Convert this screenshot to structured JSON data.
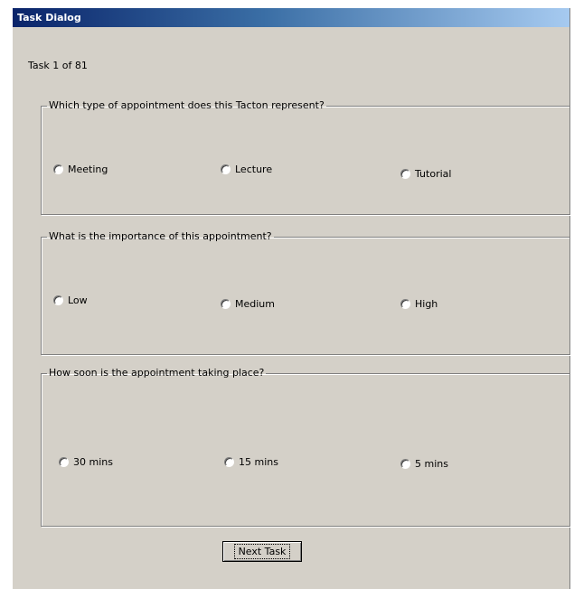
{
  "window": {
    "title": "Task Dialog"
  },
  "counter": "Task 1 of 81",
  "questions": [
    {
      "prompt": "Which type of appointment does this Tacton represent?",
      "options": [
        "Meeting",
        "Lecture",
        "Tutorial"
      ]
    },
    {
      "prompt": "What is the importance of this appointment?",
      "options": [
        "Low",
        "Medium",
        "High"
      ]
    },
    {
      "prompt": "How soon is the appointment taking place?",
      "options": [
        "30 mins",
        "15 mins",
        "5 mins"
      ]
    }
  ],
  "next_button": "Next Task"
}
